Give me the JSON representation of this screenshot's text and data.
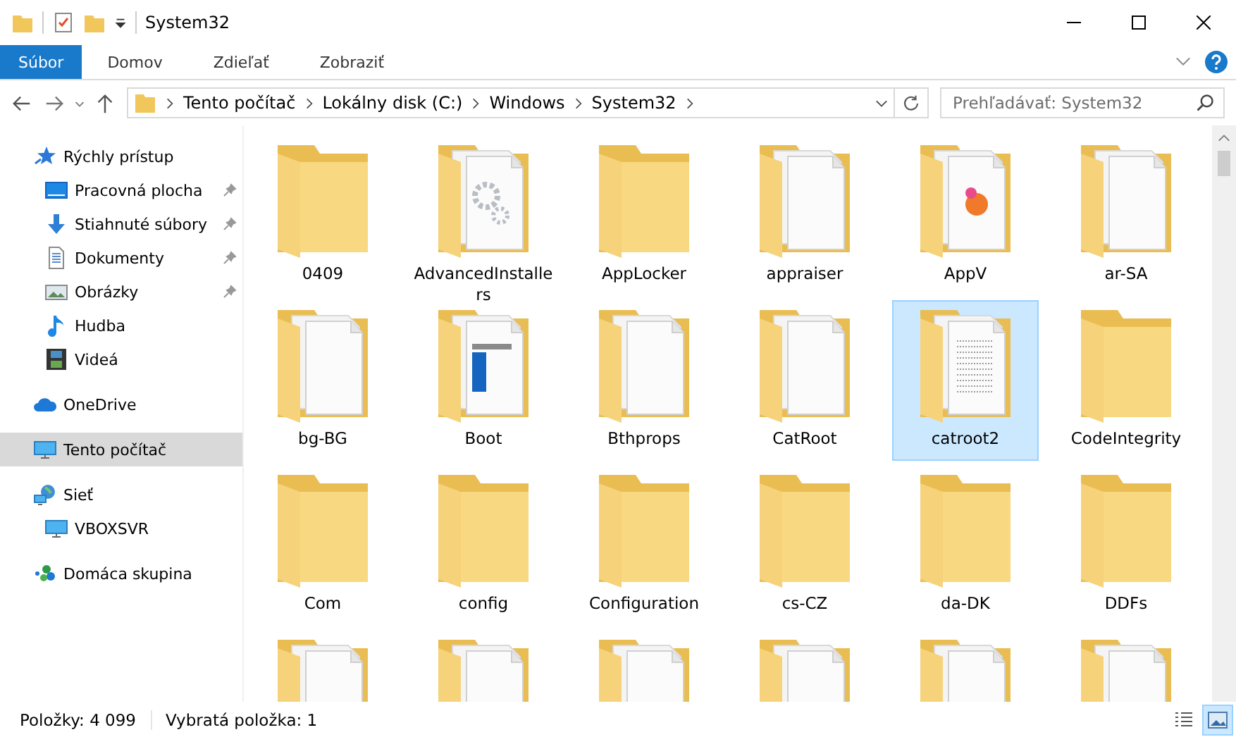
{
  "window": {
    "title": "System32"
  },
  "ribbon_tabs": [
    {
      "label": "Súbor",
      "selected": true
    },
    {
      "label": "Domov",
      "selected": false
    },
    {
      "label": "Zdieľať",
      "selected": false
    },
    {
      "label": "Zobraziť",
      "selected": false
    }
  ],
  "address_bar": {
    "segments": [
      "Tento počítač",
      "Lokálny disk (C:)",
      "Windows",
      "System32"
    ]
  },
  "search": {
    "placeholder": "Prehľadávať: System32"
  },
  "sidebar": {
    "items": [
      {
        "label": "Rýchly prístup",
        "kind": "star",
        "selected": false,
        "children": [
          {
            "label": "Pracovná plocha",
            "kind": "desktop",
            "pinned": true,
            "selected": false
          },
          {
            "label": "Stiahnuté súbory",
            "kind": "download",
            "pinned": true,
            "selected": false
          },
          {
            "label": "Dokumenty",
            "kind": "document",
            "pinned": true,
            "selected": false
          },
          {
            "label": "Obrázky",
            "kind": "pictures",
            "pinned": true,
            "selected": false
          },
          {
            "label": "Hudba",
            "kind": "music",
            "pinned": false,
            "selected": false
          },
          {
            "label": "Videá",
            "kind": "video",
            "pinned": false,
            "selected": false
          }
        ]
      },
      {
        "label": "OneDrive",
        "kind": "cloud",
        "selected": false
      },
      {
        "label": "Tento počítač",
        "kind": "computer",
        "selected": true
      },
      {
        "label": "Sieť",
        "kind": "network",
        "selected": false,
        "children": [
          {
            "label": "VBOXSVR",
            "kind": "computer",
            "selected": false
          }
        ]
      },
      {
        "label": "Domáca skupina",
        "kind": "homegroup",
        "selected": false
      }
    ]
  },
  "folders": [
    {
      "name": "0409",
      "kind": "empty",
      "selected": false
    },
    {
      "name": "AdvancedInstallers",
      "kind": "gears",
      "selected": false
    },
    {
      "name": "AppLocker",
      "kind": "empty",
      "selected": false
    },
    {
      "name": "appraiser",
      "kind": "files",
      "selected": false
    },
    {
      "name": "AppV",
      "kind": "image",
      "selected": false
    },
    {
      "name": "ar-SA",
      "kind": "files",
      "selected": false
    },
    {
      "name": "bg-BG",
      "kind": "files",
      "selected": false
    },
    {
      "name": "Boot",
      "kind": "window",
      "selected": false
    },
    {
      "name": "Bthprops",
      "kind": "files",
      "selected": false
    },
    {
      "name": "CatRoot",
      "kind": "files",
      "selected": false
    },
    {
      "name": "catroot2",
      "kind": "text",
      "selected": true
    },
    {
      "name": "CodeIntegrity",
      "kind": "empty",
      "selected": false
    },
    {
      "name": "Com",
      "kind": "empty",
      "selected": false
    },
    {
      "name": "config",
      "kind": "empty",
      "selected": false
    },
    {
      "name": "Configuration",
      "kind": "empty",
      "selected": false
    },
    {
      "name": "cs-CZ",
      "kind": "empty",
      "selected": false
    },
    {
      "name": "da-DK",
      "kind": "empty",
      "selected": false
    },
    {
      "name": "DDFs",
      "kind": "empty",
      "selected": false
    }
  ],
  "partial_folders": [
    {
      "kind": "files"
    },
    {
      "kind": "files"
    },
    {
      "kind": "files"
    },
    {
      "kind": "files"
    },
    {
      "kind": "files"
    },
    {
      "kind": "files"
    }
  ],
  "status_bar": {
    "items_count": "Položky: 4 099",
    "selection": "Vybratá položka: 1"
  },
  "view_buttons": [
    {
      "kind": "details",
      "selected": false
    },
    {
      "kind": "large-icons",
      "selected": true
    }
  ]
}
